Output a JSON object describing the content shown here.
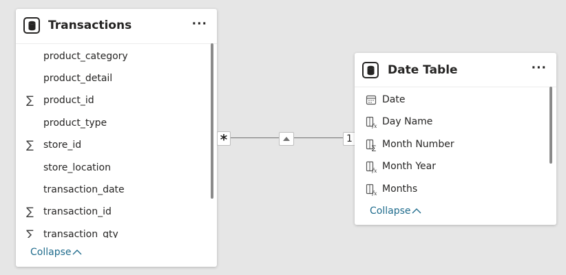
{
  "transactions_table": {
    "title": "Transactions",
    "more_label": "···",
    "fields": [
      {
        "name": "product_category",
        "icon": ""
      },
      {
        "name": "product_detail",
        "icon": ""
      },
      {
        "name": "product_id",
        "icon": "sigma"
      },
      {
        "name": "product_type",
        "icon": ""
      },
      {
        "name": "store_id",
        "icon": "sigma"
      },
      {
        "name": "store_location",
        "icon": ""
      },
      {
        "name": "transaction_date",
        "icon": ""
      },
      {
        "name": "transaction_id",
        "icon": "sigma"
      },
      {
        "name": "transaction_qty",
        "icon": "sigma"
      }
    ],
    "collapse_label": "Collapse"
  },
  "date_table": {
    "title": "Date Table",
    "more_label": "···",
    "fields": [
      {
        "name": "Date",
        "icon": "calendar-icon"
      },
      {
        "name": "Day Name",
        "icon": "calculated-column-icon"
      },
      {
        "name": "Month Number",
        "icon": "calculated-sum-column-icon"
      },
      {
        "name": "Month Year",
        "icon": "calculated-column-icon"
      },
      {
        "name": "Months",
        "icon": "calculated-column-icon"
      }
    ],
    "collapse_label": "Collapse"
  },
  "relationship": {
    "many_side": "*",
    "one_side": "1",
    "filter_direction": "single"
  },
  "colors": {
    "canvas": "#e6e6e6",
    "link": "#1e6b8c",
    "text": "#252423"
  }
}
